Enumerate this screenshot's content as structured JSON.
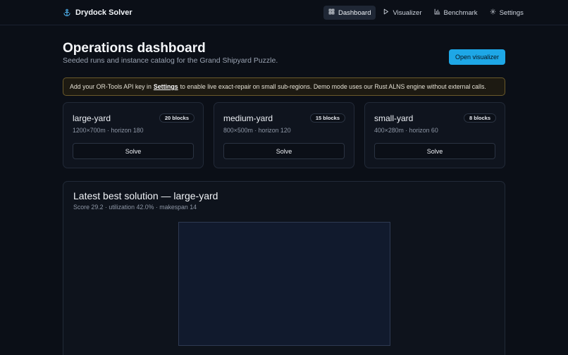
{
  "app": {
    "brand": "Drydock Solver",
    "nav": [
      {
        "label": "Dashboard",
        "icon": "grid-icon",
        "active": true
      },
      {
        "label": "Visualizer",
        "icon": "play-icon",
        "active": false
      },
      {
        "label": "Benchmark",
        "icon": "bar-chart-icon",
        "active": false
      },
      {
        "label": "Settings",
        "icon": "gear-icon",
        "active": false
      }
    ]
  },
  "header": {
    "title": "Operations dashboard",
    "subtitle": "Seeded runs and instance catalog for the Grand Shipyard Puzzle.",
    "cta_label": "Open visualizer"
  },
  "banner": {
    "prefix": "Add your OR-Tools API key in",
    "link": "Settings",
    "suffix": "to enable live exact-repair on small sub-regions. Demo mode uses our Rust ALNS engine without external calls."
  },
  "instances": [
    {
      "name": "large-yard",
      "badge": "20 blocks",
      "meta": "1200×700m · horizon 180",
      "action": "Solve"
    },
    {
      "name": "medium-yard",
      "badge": "15 blocks",
      "meta": "800×500m · horizon 120",
      "action": "Solve"
    },
    {
      "name": "small-yard",
      "badge": "8 blocks",
      "meta": "400×280m · horizon 60",
      "action": "Solve"
    }
  ],
  "latest": {
    "title": "Latest best solution — large-yard",
    "summary": "Score 29.2 · utilization 42.0% · makespan 14"
  },
  "colors": {
    "background": "#0b0f17",
    "accent": "#1ea7e6",
    "banner_border": "#6b5a2a",
    "yard_fill": "#111a2d"
  }
}
